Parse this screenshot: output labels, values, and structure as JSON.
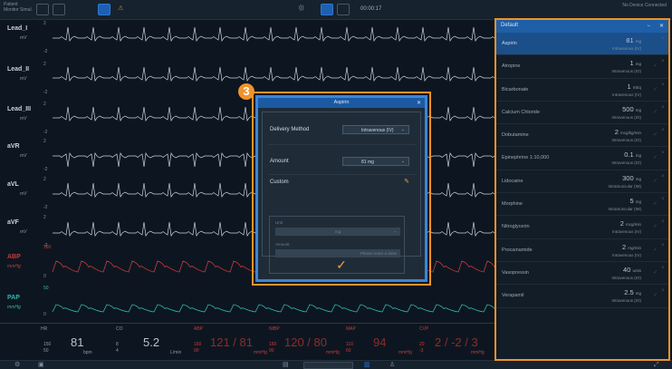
{
  "topbar": {
    "left_status": "Patient Monitor\nSimul.",
    "indicator_1": "(|)",
    "time": "00:00:17",
    "right_status": "No Device\nConnected"
  },
  "leads": [
    {
      "name": "Lead_I",
      "unit": "mV"
    },
    {
      "name": "Lead_II",
      "unit": "mV"
    },
    {
      "name": "Lead_III",
      "unit": "mV"
    },
    {
      "name": "aVR",
      "unit": "mV"
    },
    {
      "name": "aVL",
      "unit": "mV"
    },
    {
      "name": "aVF",
      "unit": "mV"
    }
  ],
  "scales": {
    "pos": "2",
    "neg": "-2"
  },
  "pressure_channels": [
    {
      "name": "ABP",
      "unit": "mmHg",
      "top": "160",
      "bottom": "0",
      "color": "#c83a3a"
    },
    {
      "name": "PAP",
      "unit": "mmHg",
      "top": "50",
      "bottom": "0",
      "color": "#2fb8b0"
    }
  ],
  "vitals": {
    "hr": {
      "label": "HR",
      "hi": "150",
      "lo": "50",
      "value": "81",
      "unit": "bpm"
    },
    "co": {
      "label": "CO",
      "hi": "8",
      "lo": "4",
      "value": "5.2",
      "unit": "L/min"
    },
    "abp": {
      "label": "ABP",
      "hi": "160",
      "lo": "90",
      "value": "121 / 81",
      "unit": "mmHg"
    },
    "nibp": {
      "label": "NIBP",
      "hi": "160",
      "lo": "90",
      "value": "120 / 80",
      "unit": "mmHg"
    },
    "map": {
      "label": "MAP",
      "hi": "110",
      "lo": "60",
      "value": "94",
      "unit": "mmHg"
    },
    "cvp": {
      "label": "CVP",
      "hi": "20",
      "lo": "-3",
      "value": "2 / -2 / 3",
      "unit": "mmHg"
    }
  },
  "drug_panel": {
    "title": "Default",
    "back_icon": "←",
    "close_icon": "✕",
    "items": [
      {
        "name": "Aspirin",
        "dose": "81",
        "unit": "mg",
        "route": "Intravenous (IV)",
        "selected": true
      },
      {
        "name": "Atropine",
        "dose": "1",
        "unit": "mg",
        "route": "Intravenous (IO)"
      },
      {
        "name": "Bicarbonate",
        "dose": "1",
        "unit": "mEq",
        "route": "Intravenous (IV)"
      },
      {
        "name": "Calcium Chloride",
        "dose": "500",
        "unit": "mg",
        "route": "Intravenous (IO)"
      },
      {
        "name": "Dobutamine",
        "dose": "2",
        "unit": "mcg/kg/min",
        "route": "Intravenous (IO)"
      },
      {
        "name": "Epinephrine 1:10,000",
        "dose": "0.1",
        "unit": "mg",
        "route": "Intravenous (IO)"
      },
      {
        "name": "Lidocaine",
        "dose": "300",
        "unit": "mg",
        "route": "Intramuscular (IM)"
      },
      {
        "name": "Morphine",
        "dose": "5",
        "unit": "mg",
        "route": "Intramuscular (IM)"
      },
      {
        "name": "Nitroglycerin",
        "dose": "2",
        "unit": "mcg/min",
        "route": "Intravenous (IV)"
      },
      {
        "name": "Procainamide",
        "dose": "2",
        "unit": "mg/min",
        "route": "Intravenous (IV)"
      },
      {
        "name": "Vasopressin",
        "dose": "40",
        "unit": "units",
        "route": "Intravenous (IO)"
      },
      {
        "name": "Verapamil",
        "dose": "2.5",
        "unit": "mg",
        "route": "Intravenous (IO)"
      }
    ]
  },
  "modal": {
    "badge": "3",
    "title": "Aspirin",
    "close_icon": "✕",
    "delivery_label": "Delivery Method",
    "delivery_value": "Intravenous (IV)",
    "amount_label": "Amount",
    "amount_value": "81 mg",
    "custom_label": "Custom",
    "edit_icon": "✎",
    "unit_label": "Unit",
    "unit_value": "mg",
    "amount_field_label": "Amount",
    "amount_placeholder": "Please enter a dose",
    "confirm_icon": "✓"
  },
  "colors": {
    "accent": "#f0932b",
    "ecg": "#c9d3dc",
    "abp": "#c83a3a",
    "pap": "#2fb8b0"
  }
}
